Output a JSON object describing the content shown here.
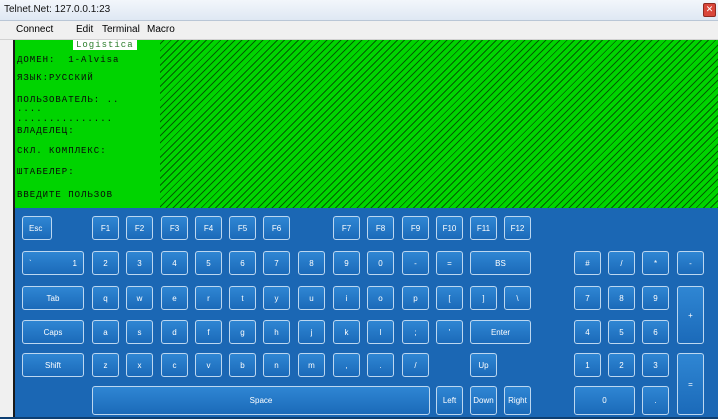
{
  "window": {
    "title": "Telnet.Net: 127.0.0.1:23",
    "close_glyph": "✕"
  },
  "menu": {
    "items": [
      "Connect",
      "Edit",
      "Terminal",
      "Macro"
    ]
  },
  "terminal": {
    "header": "Logistica",
    "lines": [
      "ДОМЕН:  1-Alvisa",
      "ЯЗЫК:РУССКИЙ",
      "ПОЛЬЗОВАТЕЛЬ: ..",
      "....",
      "...............",
      "ВЛАДЕЛЕЦ:",
      "СКЛ. КОМПЛЕКС:",
      "ШТАБЕЛЕР:",
      "ВВЕДИТЕ ПОЛЬЗОВ"
    ],
    "bg_color": "#00d400"
  },
  "keyboard": {
    "rows": {
      "fn": [
        "Esc",
        "F1",
        "F2",
        "F3",
        "F4",
        "F5",
        "F6",
        "F7",
        "F8",
        "F9",
        "F10",
        "F11",
        "F12"
      ],
      "num": [
        "`",
        "1",
        "2",
        "3",
        "4",
        "5",
        "6",
        "7",
        "8",
        "9",
        "0",
        "-",
        "=",
        "BS"
      ],
      "q": [
        "Tab",
        "q",
        "w",
        "e",
        "r",
        "t",
        "y",
        "u",
        "i",
        "o",
        "p",
        "[",
        "]",
        "\\"
      ],
      "a": [
        "Caps",
        "a",
        "s",
        "d",
        "f",
        "g",
        "h",
        "j",
        "k",
        "l",
        ";",
        "'",
        "Enter"
      ],
      "z": [
        "Shift",
        "z",
        "x",
        "c",
        "v",
        "b",
        "n",
        "m",
        ",",
        ".",
        "/",
        "Up"
      ],
      "bottom": [
        "Space",
        "Left",
        "Down",
        "Right"
      ]
    },
    "numpad": [
      "#",
      "/",
      "*",
      "-",
      "7",
      "8",
      "9",
      "+",
      "4",
      "5",
      "6",
      "1",
      "2",
      "3",
      "=",
      "0",
      "."
    ],
    "accent": "#1b67b4"
  }
}
